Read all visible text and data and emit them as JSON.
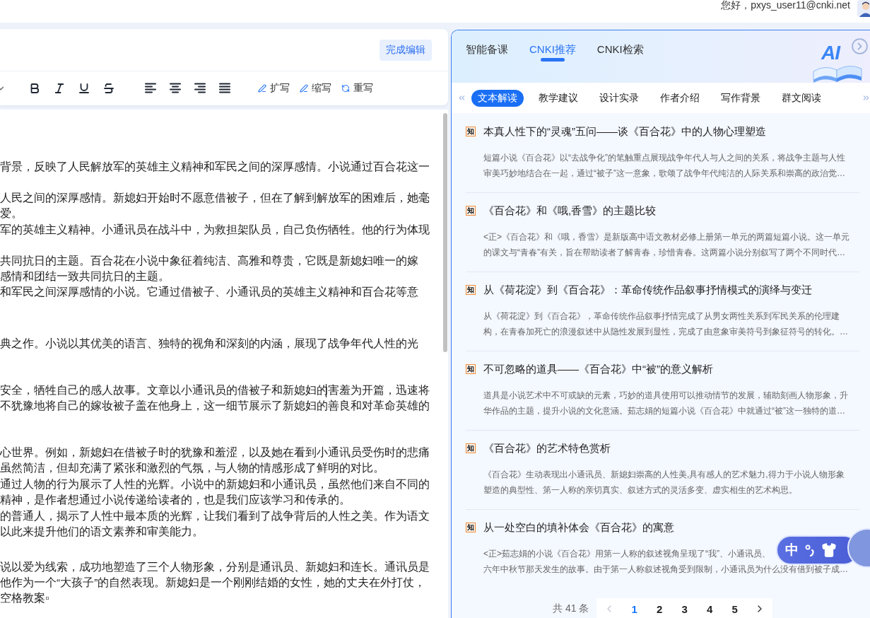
{
  "header": {
    "greeting": "您好，pxys_user11@cnki.net"
  },
  "editor": {
    "done_button": "完成编辑",
    "ai_actions": [
      {
        "kind": "expand",
        "label": "扩写"
      },
      {
        "kind": "shrink",
        "label": "缩写"
      },
      {
        "kind": "rewrite",
        "label": "重写"
      }
    ],
    "caret_visible": true,
    "paragraphs": [
      {
        "lines": [
          "背景，反映了人民解放军的英雄主义精神和军民之间的深厚感情。小说通过百合花这一"
        ]
      },
      {
        "lines": [
          "人民之间的深厚感情。新媳妇开始时不愿意借被子，但在了解到解放军的困难后，她毫",
          "爱。"
        ]
      },
      {
        "lines": [
          "军的英雄主义精神。小通讯员在战斗中，为救担架队员，自己负伤牺牲。他的行为体现"
        ]
      },
      {
        "lines": [
          "共同抗日的主题。百合花在小说中象征着纯洁、高雅和尊贵，它既是新媳妇唯一的嫁",
          "感情和团结一致共同抗日的主题。"
        ]
      },
      {
        "lines": [
          "和军民之间深厚感情的小说。它通过借被子、小通讯员的英雄主义精神和百合花等意"
        ]
      },
      {
        "lines": [
          "典之作。小说以其优美的语言、独特的视角和深刻的内涵，展现了战争年代人性的光"
        ]
      },
      {
        "lines": [
          "安全，牺牲自己的感人故事。文章以小通讯员的借被子和新媳妇的害羞为开篇，迅速将",
          "不犹豫地将自己的嫁妆被子盖在他身上，这一细节展示了新媳妇的善良和对革命英雄的"
        ]
      },
      {
        "lines": [
          "心世界。例如，新媳妇在借被子时的犹豫和羞涩，以及她在看到小通讯员受伤时的悲痛",
          "虽然简洁，但却充满了紧张和激烈的气氛，与人物的情感形成了鲜明的对比。"
        ]
      },
      {
        "lines": [
          "通过人物的行为展示了人性的光辉。小说中的新媳妇和小通讯员，虽然他们来自不同的",
          "精神，是作者想通过小说传递给读者的，也是我们应该学习和传承的。"
        ]
      },
      {
        "lines": [
          "的普通人，揭示了人性中最本质的光辉，让我们看到了战争背后的人性之美。作为语文",
          "以此来提升他们的语文素养和审美能力。"
        ]
      },
      {
        "lines": [
          "说以爱为线索，成功地塑造了三个人物形象，分别是通讯员、新媳妇和连长。通讯员是",
          "他作为一个“大孩子”的自然表现。新媳妇是一个刚刚结婚的女性，她的丈夫在外打仗，",
          "空格教案▫"
        ]
      }
    ]
  },
  "assistant": {
    "tabs": [
      {
        "label": "智能备课",
        "selected": false
      },
      {
        "label": "CNKI推荐",
        "selected": true
      },
      {
        "label": "CNKI检索",
        "selected": false
      }
    ],
    "illustration_label": "AI",
    "subtabs": [
      {
        "label": "文本解读",
        "selected": true
      },
      {
        "label": "教学建议",
        "selected": false
      },
      {
        "label": "设计实录",
        "selected": false
      },
      {
        "label": "作者介绍",
        "selected": false
      },
      {
        "label": "写作背景",
        "selected": false
      },
      {
        "label": "群文阅读",
        "selected": false
      }
    ],
    "articles": [
      {
        "badge": "知",
        "title": "本真人性下的“灵魂”五问——谈《百合花》中的人物心理塑造",
        "summary_lines": [
          "短篇小说《百合花》以“去战争化”的笔触重点展现战争年代人与人之间的关系，将战争主题与人性",
          "审美巧妙地结合在一起，通过“被子”这一意象，歌颂了战争年代纯洁的人际关系和崇高的政治觉…"
        ]
      },
      {
        "badge": "知",
        "title": "《百合花》和《哦,香雪》的主题比较",
        "summary_lines": [
          "<正>《百合花》和《哦，香雪》是新版高中语文教材必修上册第一单元的两篇短篇小说。这一单元",
          "的课文与“青春”有关，旨在帮助读者了解青春，珍惜青春。这两篇小说分别叙写了两个不同时代…"
        ]
      },
      {
        "badge": "知",
        "title": "从《荷花淀》到《百合花》：革命传统作品叙事抒情模式的演绎与变迁",
        "summary_lines": [
          "从《荷花淀》到《百合花》，革命传统作品叙事抒情完成了从男女两性关系到军民关系的伦理建",
          "构，在青春加死亡的浪漫叙述中从隐性发展到显性，完成了由意象审美符号到象征符号的转化。…"
        ]
      },
      {
        "badge": "知",
        "title": "不可忽略的道具——《百合花》中“被”的意义解析",
        "summary_lines": [
          "道具是小说艺术中不可或缺的元素，巧妙的道具使用可以推动情节的发展，辅助刻画人物形象，升",
          "华作品的主题，提升小说的文化意涵。茹志娟的短篇小说《百合花》中就通过“被”这一独特的道…"
        ]
      },
      {
        "badge": "知",
        "title": "《百合花》的艺术特色赏析",
        "summary_lines": [
          "《百合花》生动表现出小通讯员、新媳妇崇高的人性美,具有感人的艺术魅力,得力于小说人物形象",
          "塑造的典型性、第一人称的亲切真实、叙述方式的灵活多变、虚实相生的艺术构思。"
        ]
      },
      {
        "badge": "知",
        "title": "从一处空白的填补体会《百合花》的寓意",
        "summary_lines": [
          "<正>茹志娟的小说《百合花》用第一人称的叙述视角呈现了“我”、小通讯员、",
          "六年中秋节那天发生的故事。由于第一人称叙述视角受到限制，小通讯员为什么没有借到被子成…"
        ]
      }
    ],
    "pagination": {
      "total": "共 41 条",
      "prev_disabled": true,
      "next_disabled": false,
      "pages": [
        {
          "label": "1",
          "selected": true
        },
        {
          "label": "2",
          "selected": false
        },
        {
          "label": "3",
          "selected": false
        },
        {
          "label": "4",
          "selected": false
        },
        {
          "label": "5",
          "selected": false
        }
      ]
    }
  },
  "ime_toolbar": {
    "mode": "中"
  }
}
